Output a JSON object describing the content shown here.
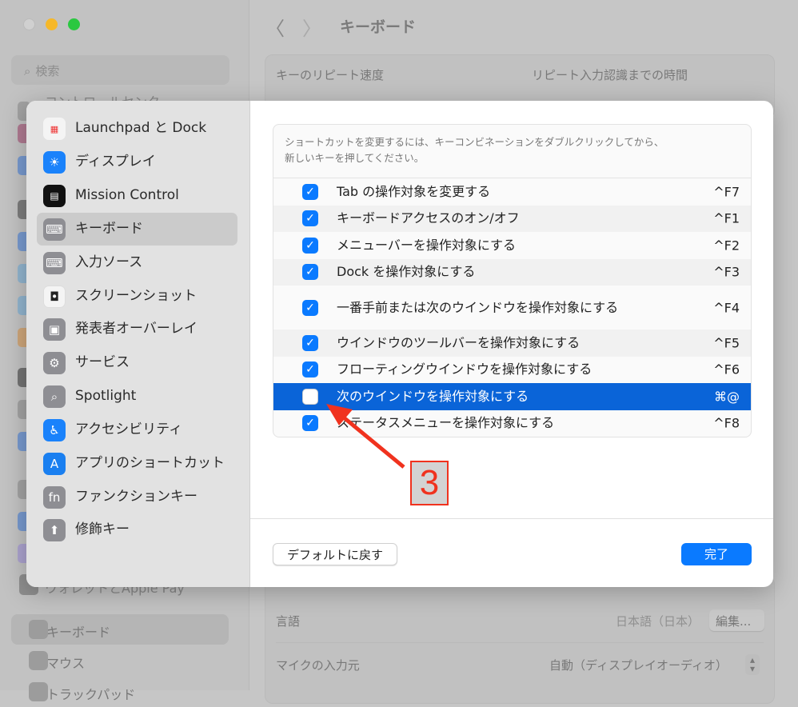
{
  "window": {
    "title": "キーボード",
    "search_placeholder": "検索",
    "back": "〈",
    "forward": "〉"
  },
  "bg_sidebar": {
    "partial_top": "コントロールセンター",
    "partial_bottom": "ウォレットとApple Pay",
    "items": [
      {
        "label": "キーボード",
        "selected": true
      },
      {
        "label": "マウス"
      },
      {
        "label": "トラックパッド"
      }
    ]
  },
  "bg_main": {
    "repeat_speed": "キーのリピート速度",
    "repeat_delay": "リピート入力認識までの時間",
    "language_label": "言語",
    "language_value": "日本語（日本）",
    "edit_button": "編集...",
    "mic_label": "マイクの入力元",
    "mic_value": "自動（ディスプレイオーディオ）"
  },
  "dialog": {
    "sidebar": [
      {
        "label": "Launchpad と Dock",
        "icon": "launchpad-icon"
      },
      {
        "label": "ディスプレイ",
        "icon": "display-icon"
      },
      {
        "label": "Mission Control",
        "icon": "mission-control-icon"
      },
      {
        "label": "キーボード",
        "icon": "keyboard-icon",
        "selected": true
      },
      {
        "label": "入力ソース",
        "icon": "keyboard-icon"
      },
      {
        "label": "スクリーンショット",
        "icon": "screenshot-icon"
      },
      {
        "label": "発表者オーバーレイ",
        "icon": "presenter-icon"
      },
      {
        "label": "サービス",
        "icon": "gears-icon"
      },
      {
        "label": "Spotlight",
        "icon": "search-icon"
      },
      {
        "label": "アクセシビリティ",
        "icon": "accessibility-icon"
      },
      {
        "label": "アプリのショートカット",
        "icon": "app-store-icon"
      },
      {
        "label": "ファンクションキー",
        "icon": "fn-icon",
        "glyph": "fn"
      },
      {
        "label": "修飾キー",
        "icon": "arrow-up-icon"
      }
    ],
    "hint_line1": "ショートカットを変更するには、キーコンビネーションをダブルクリックしてから、",
    "hint_line2": "新しいキーを押してください。",
    "shortcuts": [
      {
        "label": "Tab の操作対象を変更する",
        "key": "^F7",
        "checked": true
      },
      {
        "label": "キーボードアクセスのオン/オフ",
        "key": "^F1",
        "checked": true
      },
      {
        "label": "メニューバーを操作対象にする",
        "key": "^F2",
        "checked": true
      },
      {
        "label": "Dock を操作対象にする",
        "key": "^F3",
        "checked": true
      },
      {
        "label": "一番手前または次のウインドウを操作対象にする",
        "key": "^F4",
        "checked": true
      },
      {
        "label": "ウインドウのツールバーを操作対象にする",
        "key": "^F5",
        "checked": true
      },
      {
        "label": "フローティングウインドウを操作対象にする",
        "key": "^F6",
        "checked": true
      },
      {
        "label": "次のウインドウを操作対象にする",
        "key": "⌘@",
        "checked": false,
        "selected": true
      },
      {
        "label": "ステータスメニューを操作対象にする",
        "key": "^F8",
        "checked": true
      }
    ],
    "default_button": "デフォルトに戻す",
    "done_button": "完了"
  },
  "annotation": {
    "label": "3",
    "color": "#f0321e"
  },
  "colors": {
    "accent": "#0a7aff",
    "selection": "#0a64d8"
  }
}
